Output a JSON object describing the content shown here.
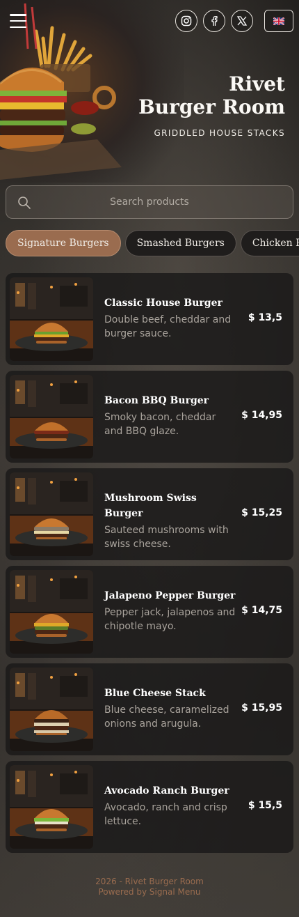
{
  "header": {
    "menu_icon": "hamburger-menu-icon",
    "socials": [
      {
        "icon": "instagram-icon"
      },
      {
        "icon": "facebook-icon"
      },
      {
        "icon": "x-twitter-icon"
      }
    ],
    "language_icon": "uk-flag-icon",
    "brand_line1": "Rivet",
    "brand_line2": "Burger Room",
    "tagline": "GRIDDLED HOUSE STACKS"
  },
  "search": {
    "placeholder": "Search products",
    "icon": "search-icon"
  },
  "categories": [
    {
      "label": "Signature Burgers",
      "active": true
    },
    {
      "label": "Smashed Burgers",
      "active": false
    },
    {
      "label": "Chicken Burgers",
      "active": false
    }
  ],
  "products": [
    {
      "name": "Classic House Burger",
      "description": "Double beef, cheddar and burger sauce.",
      "price": "$ 13,5"
    },
    {
      "name": "Bacon BBQ Burger",
      "description": "Smoky bacon, cheddar and BBQ glaze.",
      "price": "$ 14,95"
    },
    {
      "name": "Mushroom Swiss Burger",
      "description": "Sauteed mushrooms with swiss cheese.",
      "price": "$ 15,25"
    },
    {
      "name": "Jalapeno Pepper Burger",
      "description": "Pepper jack, jalapenos and chipotle mayo.",
      "price": "$ 14,75"
    },
    {
      "name": "Blue Cheese Stack",
      "description": "Blue cheese, caramelized onions and arugula.",
      "price": "$ 15,95"
    },
    {
      "name": "Avocado Ranch Burger",
      "description": "Avocado, ranch and crisp lettuce.",
      "price": "$ 15,5"
    }
  ],
  "footer": {
    "copyright": "2026 - Rivet Burger Room",
    "powered_by": "Powered by Signal Menu"
  },
  "colors": {
    "accent": "#9a6c4f",
    "card_bg": "#1a1918",
    "text_muted": "#a9a39c"
  }
}
